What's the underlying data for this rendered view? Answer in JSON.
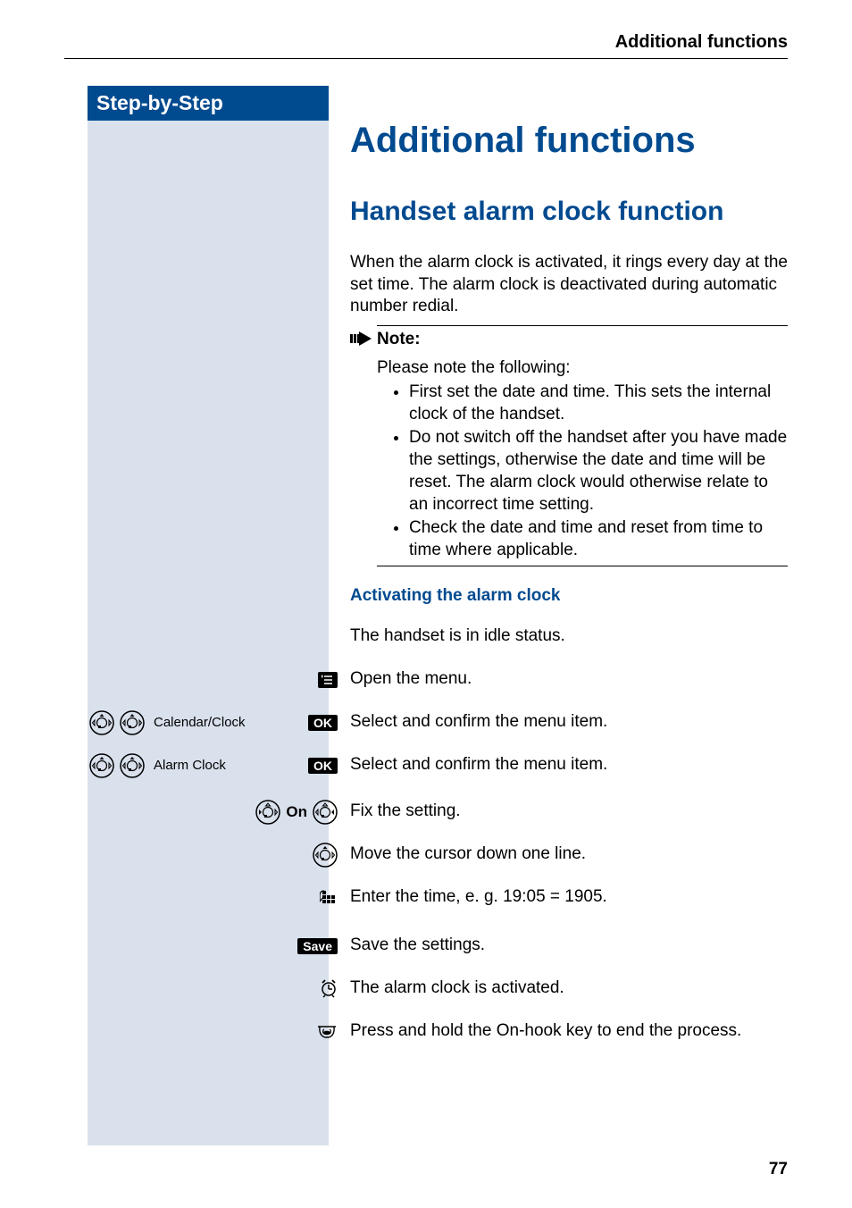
{
  "header": {
    "section": "Additional functions"
  },
  "sidebar": {
    "tab": "Step-by-Step"
  },
  "titles": {
    "h1": "Additional functions",
    "h2": "Handset alarm clock function",
    "h3": "Activating the alarm clock"
  },
  "intro": "When the alarm clock is activated, it rings every day at the set time. The alarm clock is deactivated during automatic number redial.",
  "note": {
    "title": "Note:",
    "lead": "Please note the following:",
    "items": [
      "First set the date and time. This sets the internal clock of the handset.",
      "Do not switch off the handset after you have made the settings, otherwise the date and time will be reset. The alarm clock would otherwise relate to an incorrect time setting.",
      "Check the date and time and reset from time to time where applicable."
    ]
  },
  "steps": {
    "idle": "The handset is in idle status.",
    "open_menu": "Open the menu.",
    "calendar_label": "Calendar/Clock",
    "calendar_text": "Select and confirm the menu item.",
    "alarm_label": "Alarm Clock",
    "alarm_text": "Select and confirm the menu item.",
    "on_label": "On",
    "fix": "Fix the setting.",
    "cursor": "Move the cursor down one line.",
    "time": "Enter the time, e. g. 19:05 = 1905.",
    "save": "Save the settings.",
    "activated": "The alarm clock is activated.",
    "hold": "Press and hold the On-hook key to end the process."
  },
  "buttons": {
    "ok": "OK",
    "save": "Save"
  },
  "page": "77"
}
